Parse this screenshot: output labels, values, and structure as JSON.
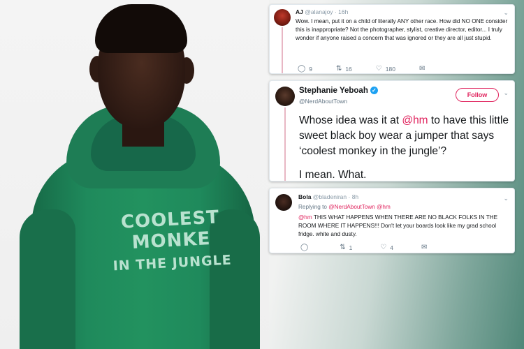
{
  "photo": {
    "sweatshirt_line1": "COOLEST MONKE",
    "sweatshirt_line2": "IN THE JUNGLE"
  },
  "tweet1": {
    "name": "AJ",
    "handle": "@alanajoy",
    "time": "· 16h",
    "text": "Wow. I mean, put it on a child of literally ANY other race. How did NO ONE consider this is inappropriate? Not the photographer, stylist, creative director, editor... I truly wonder if anyone raised a concern that was ignored or they are all just stupid.",
    "replies": "9",
    "retweets": "16",
    "likes": "180"
  },
  "tweet2": {
    "name": "Stephanie Yeboah",
    "handle": "@NerdAboutTown",
    "follow_label": "Follow",
    "text_a": "Whose idea was it at ",
    "mention": "@hm",
    "text_b": " to have this little sweet black boy wear a jumper that says ‘coolest monkey in the jungle’?",
    "text_c": "I mean. What."
  },
  "tweet3": {
    "name": "Bola",
    "handle": "@bladeniran",
    "time": "· 8h",
    "replying_label": "Replying to ",
    "replying_to": "@NerdAboutTown @hm",
    "mention": "@hm",
    "text": " THIS WHAT HAPPENS WHEN THERE ARE NO BLACK FOLKS IN THE ROOM WHERE IT HAPPENS!!! Don't let your boards look like my grad school fridge. white and dusty.",
    "retweets": "1",
    "likes": "4"
  },
  "icons": {
    "reply": "reply-icon",
    "retweet": "retweet-icon",
    "like": "heart-icon",
    "dm": "envelope-icon",
    "more": "chevron-down-icon",
    "verified": "verified-badge-icon"
  },
  "colors": {
    "twitter_blue": "#1da1f2",
    "mention_pink": "#e0245e",
    "sweatshirt_green": "#1f8a5c"
  }
}
